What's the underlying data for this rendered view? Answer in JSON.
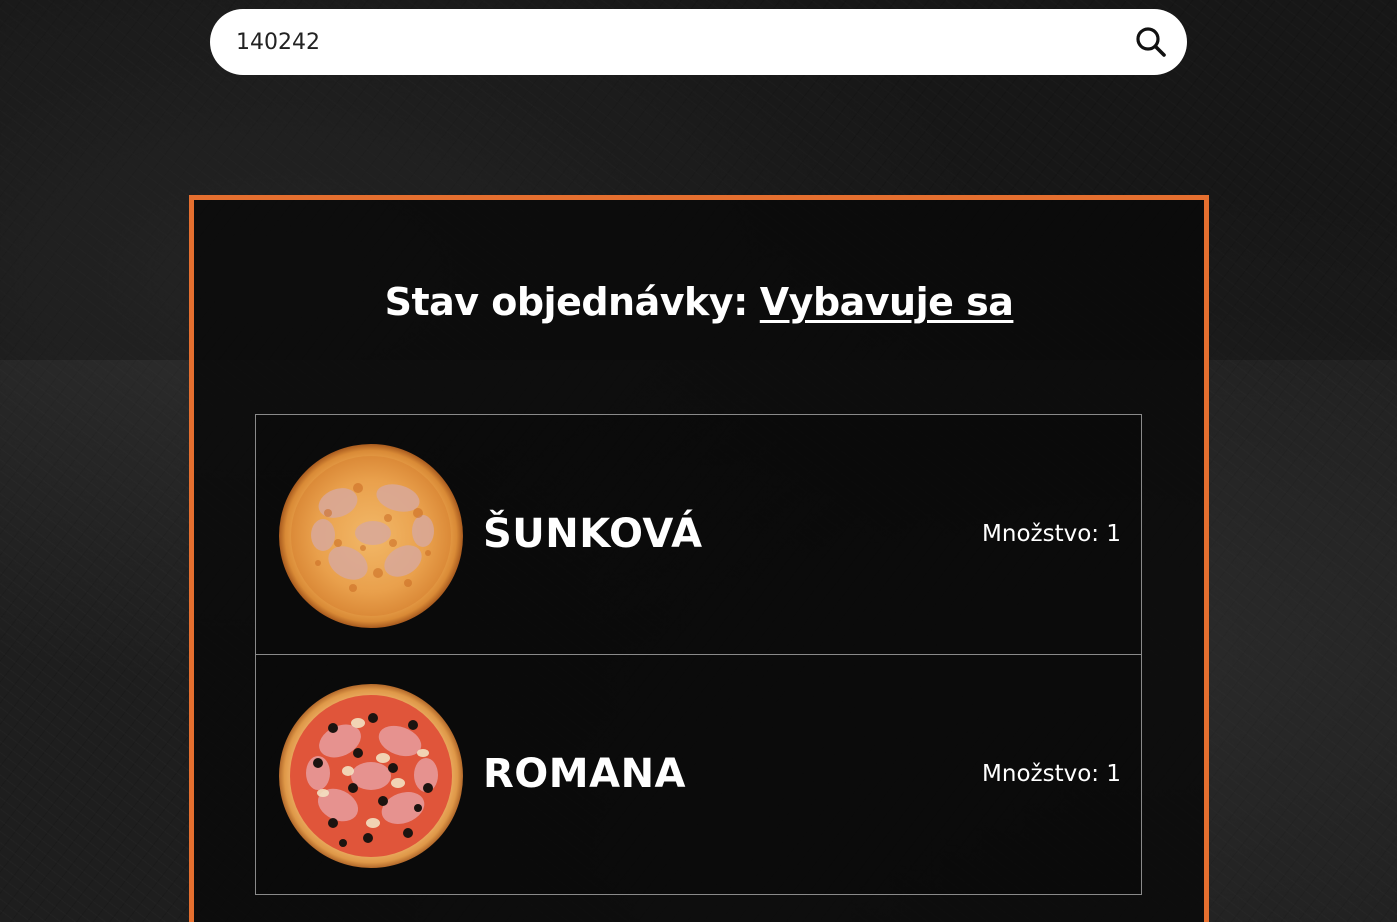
{
  "search": {
    "value": "140242",
    "icon": "search-icon"
  },
  "order": {
    "status_label": "Stav objednávky:",
    "status_value": "Vybavuje sa",
    "accent_color": "#e56f2f",
    "items": [
      {
        "name": "ŠUNKOVÁ",
        "quantity_text": "Množstvo: 1",
        "image": "pizza-sunkova-image"
      },
      {
        "name": "ROMANA",
        "quantity_text": "Množstvo: 1",
        "image": "pizza-romana-image"
      }
    ]
  }
}
